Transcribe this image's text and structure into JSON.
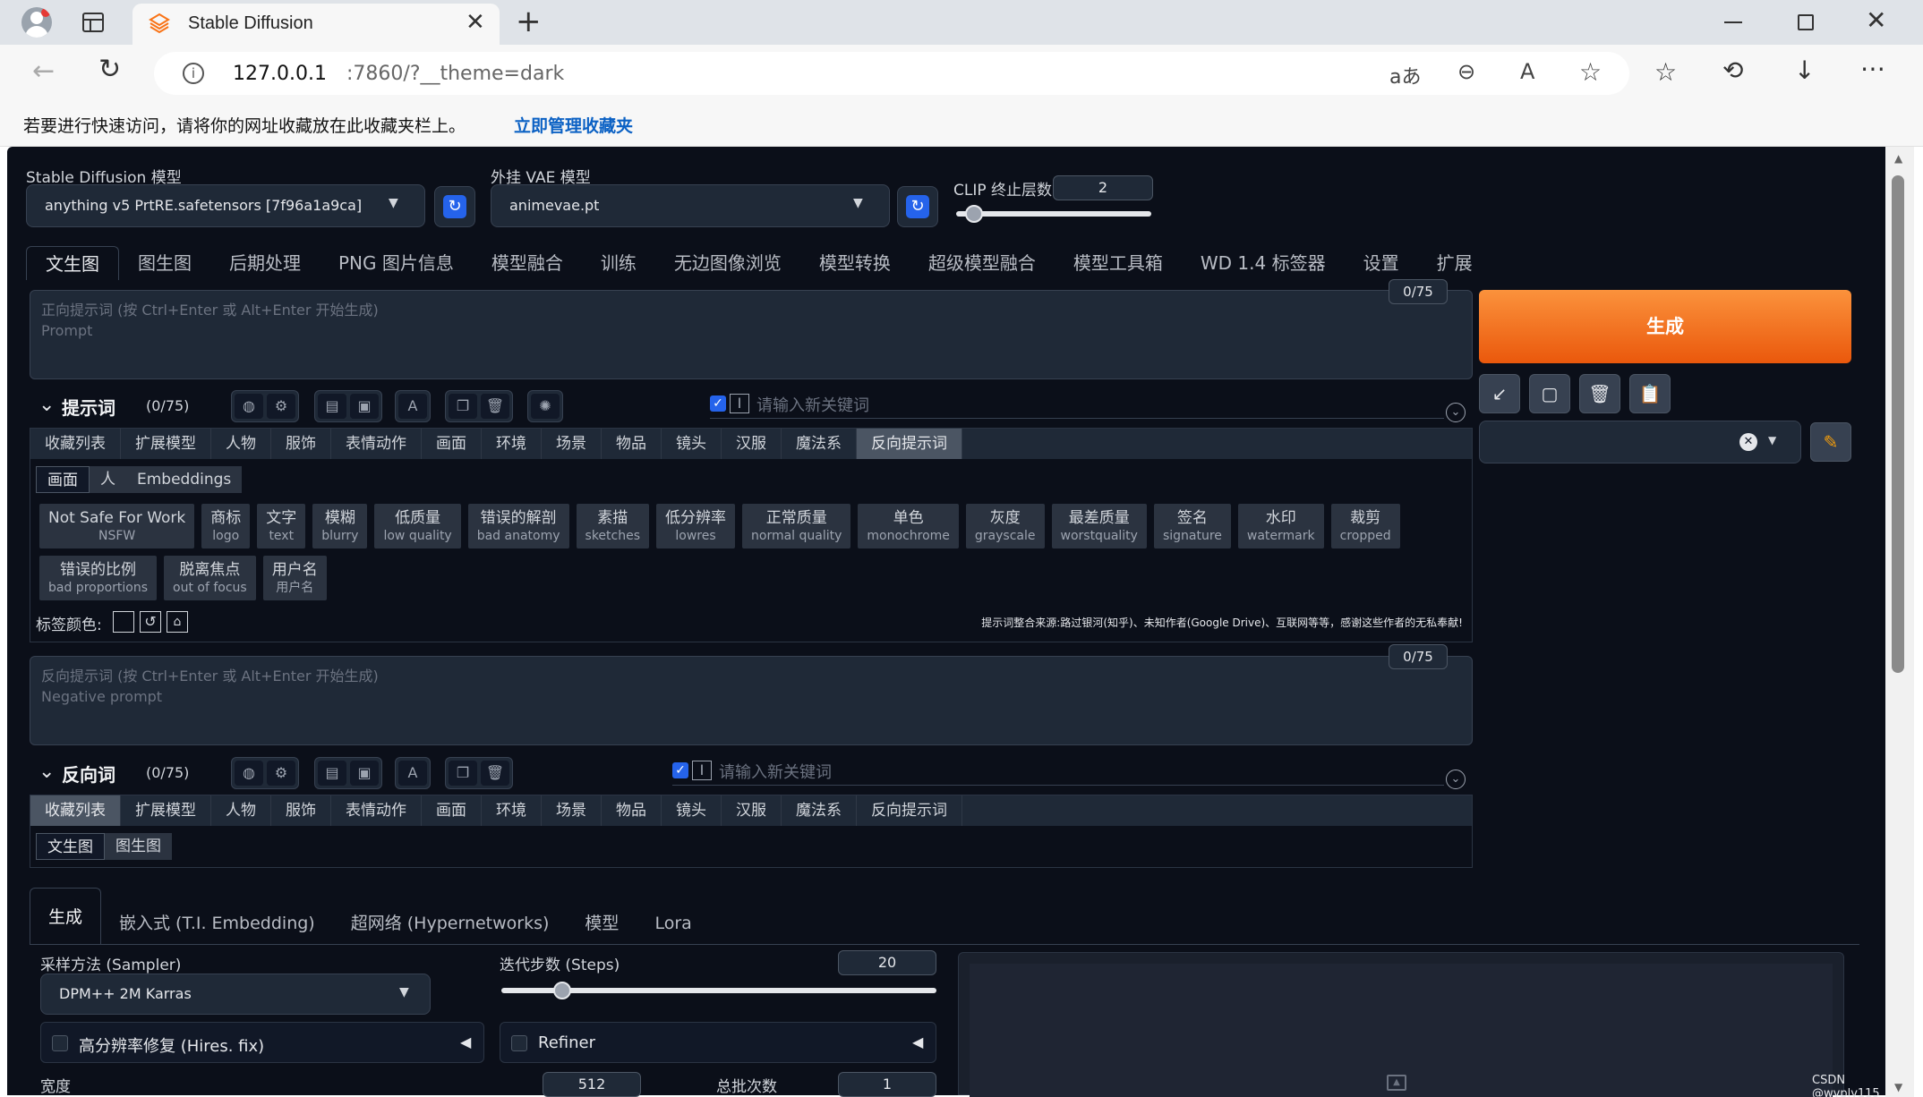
{
  "browser": {
    "tab_title": "Stable Diffusion",
    "url_host": "127.0.0.1",
    "url_rest": ":7860/?__theme=dark",
    "favbar_text": "若要进行快速访问，请将你的网址收藏放在此收藏夹栏上。",
    "favbar_link": "立即管理收藏夹"
  },
  "top": {
    "sd_model_label": "Stable Diffusion 模型",
    "sd_model_value": "anything v5 PrtRE.safetensors [7f96a1a9ca]",
    "vae_label": "外挂 VAE 模型",
    "vae_value": "animevae.pt",
    "clip_label": "CLIP 终止层数",
    "clip_value": "2",
    "clip_fraction": 0.09
  },
  "main_tabs": [
    "文生图",
    "图生图",
    "后期处理",
    "PNG 图片信息",
    "模型融合",
    "训练",
    "无边图像浏览",
    "模型转换",
    "超级模型融合",
    "模型工具箱",
    "WD 1.4 标签器",
    "设置",
    "扩展"
  ],
  "prompt": {
    "placeholder": "正向提示词 (按 Ctrl+Enter 或 Alt+Enter 开始生成)\nPrompt",
    "token_count": "0/75",
    "section_label": "提示词",
    "section_count": "(0/75)",
    "keyword_placeholder": "请输入新关键词"
  },
  "categories": [
    "收藏列表",
    "扩展模型",
    "人物",
    "服饰",
    "表情动作",
    "画面",
    "环境",
    "场景",
    "物品",
    "镜头",
    "汉服",
    "魔法系",
    "反向提示词"
  ],
  "subtabs": [
    "画面",
    "人",
    "Embeddings"
  ],
  "chips": [
    {
      "zh": "Not Safe For Work",
      "en": "NSFW"
    },
    {
      "zh": "商标",
      "en": "logo"
    },
    {
      "zh": "文字",
      "en": "text"
    },
    {
      "zh": "模糊",
      "en": "blurry"
    },
    {
      "zh": "低质量",
      "en": "low quality"
    },
    {
      "zh": "错误的解剖",
      "en": "bad anatomy"
    },
    {
      "zh": "素描",
      "en": "sketches"
    },
    {
      "zh": "低分辨率",
      "en": "lowres"
    },
    {
      "zh": "正常质量",
      "en": "normal quality"
    },
    {
      "zh": "单色",
      "en": "monochrome"
    },
    {
      "zh": "灰度",
      "en": "grayscale"
    },
    {
      "zh": "最差质量",
      "en": "worstquality"
    },
    {
      "zh": "签名",
      "en": "signature"
    },
    {
      "zh": "水印",
      "en": "watermark"
    },
    {
      "zh": "裁剪",
      "en": "cropped"
    },
    {
      "zh": "错误的比例",
      "en": "bad proportions"
    },
    {
      "zh": "脱离焦点",
      "en": "out of focus"
    },
    {
      "zh": "用户名",
      "en": "用户名"
    }
  ],
  "tag_color_label": "标签颜色:",
  "credits": "提示词整合来源:路过银河(知乎)、未知作者(Google Drive)、互联网等等，感谢这些作者的无私奉献!",
  "negative": {
    "placeholder": "反向提示词 (按 Ctrl+Enter 或 Alt+Enter 开始生成)\nNegative prompt",
    "token_count": "0/75",
    "section_label": "反向词",
    "section_count": "(0/75)",
    "keyword_placeholder": "请输入新关键词",
    "subtabs": [
      "文生图",
      "图生图"
    ]
  },
  "generate_label": "生成",
  "bottom_tabs": [
    "生成",
    "嵌入式 (T.I. Embedding)",
    "超网络 (Hypernetworks)",
    "模型",
    "Lora"
  ],
  "sampler": {
    "label": "采样方法 (Sampler)",
    "value": "DPM++ 2M Karras"
  },
  "steps": {
    "label": "迭代步数 (Steps)",
    "value": "20",
    "fraction": 0.14
  },
  "hires_label": "高分辨率修复 (Hires. fix)",
  "refiner_label": "Refiner",
  "width": {
    "label": "宽度",
    "value": "512"
  },
  "batch": {
    "label": "总批次数",
    "value": "1"
  },
  "watermark": "CSDN @wyply115"
}
